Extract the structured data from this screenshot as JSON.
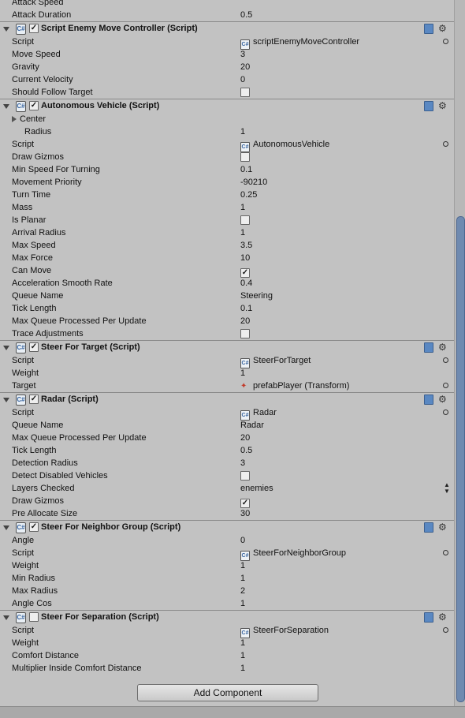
{
  "partial_top": {
    "label": "Attack Speed"
  },
  "attack_duration": {
    "label": "Attack Duration",
    "value": "0.5"
  },
  "components": [
    {
      "title": "Script Enemy Move Controller (Script)",
      "enabled": true,
      "rows": [
        {
          "label": "Script",
          "value": "scriptEnemyMoveController",
          "kind": "script"
        },
        {
          "label": "Move Speed",
          "value": "3"
        },
        {
          "label": "Gravity",
          "value": "20"
        },
        {
          "label": "Current Velocity",
          "value": "0"
        },
        {
          "label": "Should Follow Target",
          "checked": false,
          "kind": "checkbox"
        }
      ]
    },
    {
      "title": "Autonomous Vehicle (Script)",
      "enabled": true,
      "rows": [
        {
          "label": "Center",
          "kind": "foldout"
        },
        {
          "label": "Radius",
          "value": "1",
          "indent": true
        },
        {
          "label": "Script",
          "value": "AutonomousVehicle",
          "kind": "script"
        },
        {
          "label": "Draw Gizmos",
          "checked": false,
          "kind": "checkbox"
        },
        {
          "label": "Min Speed For Turning",
          "value": "0.1"
        },
        {
          "label": "Movement Priority",
          "value": "-90210"
        },
        {
          "label": "Turn Time",
          "value": "0.25"
        },
        {
          "label": "Mass",
          "value": "1"
        },
        {
          "label": "Is Planar",
          "checked": false,
          "kind": "checkbox"
        },
        {
          "label": "Arrival Radius",
          "value": "1"
        },
        {
          "label": "Max Speed",
          "value": "3.5"
        },
        {
          "label": "Max Force",
          "value": "10"
        },
        {
          "label": "Can Move",
          "checked": true,
          "kind": "checkbox"
        },
        {
          "label": "Acceleration Smooth Rate",
          "value": "0.4"
        },
        {
          "label": "Queue Name",
          "value": "Steering"
        },
        {
          "label": "Tick Length",
          "value": "0.1"
        },
        {
          "label": "Max Queue Processed Per Update",
          "value": "20"
        },
        {
          "label": "Trace Adjustments",
          "checked": false,
          "kind": "checkbox"
        }
      ]
    },
    {
      "title": "Steer For Target (Script)",
      "enabled": true,
      "rows": [
        {
          "label": "Script",
          "value": "SteerForTarget",
          "kind": "script"
        },
        {
          "label": "Weight",
          "value": "1"
        },
        {
          "label": "Target",
          "value": "prefabPlayer (Transform)",
          "kind": "object"
        }
      ]
    },
    {
      "title": "Radar (Script)",
      "enabled": true,
      "rows": [
        {
          "label": "Script",
          "value": "Radar",
          "kind": "script"
        },
        {
          "label": "Queue Name",
          "value": "Radar"
        },
        {
          "label": "Max Queue Processed Per Update",
          "value": "20"
        },
        {
          "label": "Tick Length",
          "value": "0.5"
        },
        {
          "label": "Detection Radius",
          "value": "3"
        },
        {
          "label": "Detect Disabled Vehicles",
          "checked": false,
          "kind": "checkbox"
        },
        {
          "label": "Layers Checked",
          "value": "enemies",
          "kind": "dropdown"
        },
        {
          "label": "Draw Gizmos",
          "checked": true,
          "kind": "checkbox"
        },
        {
          "label": "Pre Allocate Size",
          "value": "30"
        }
      ]
    },
    {
      "title": "Steer For Neighbor Group (Script)",
      "enabled": true,
      "rows": [
        {
          "label": "Angle",
          "value": "0"
        },
        {
          "label": "Script",
          "value": "SteerForNeighborGroup",
          "kind": "script"
        },
        {
          "label": "Weight",
          "value": "1"
        },
        {
          "label": "Min Radius",
          "value": "1"
        },
        {
          "label": "Max Radius",
          "value": "2"
        },
        {
          "label": "Angle Cos",
          "value": "1"
        }
      ]
    },
    {
      "title": "Steer For Separation (Script)",
      "enabled": false,
      "rows": [
        {
          "label": "Script",
          "value": "SteerForSeparation",
          "kind": "script"
        },
        {
          "label": "Weight",
          "value": "1"
        },
        {
          "label": "Comfort Distance",
          "value": "1"
        },
        {
          "label": "Multiplier Inside Comfort Distance",
          "value": "1"
        }
      ]
    }
  ],
  "add_component_label": "Add Component",
  "icons": {
    "fold": "foldout-triangle-icon",
    "component": "script-component-icon",
    "help": "help-book-icon",
    "settings": "gear-icon",
    "picker": "object-picker-icon"
  }
}
